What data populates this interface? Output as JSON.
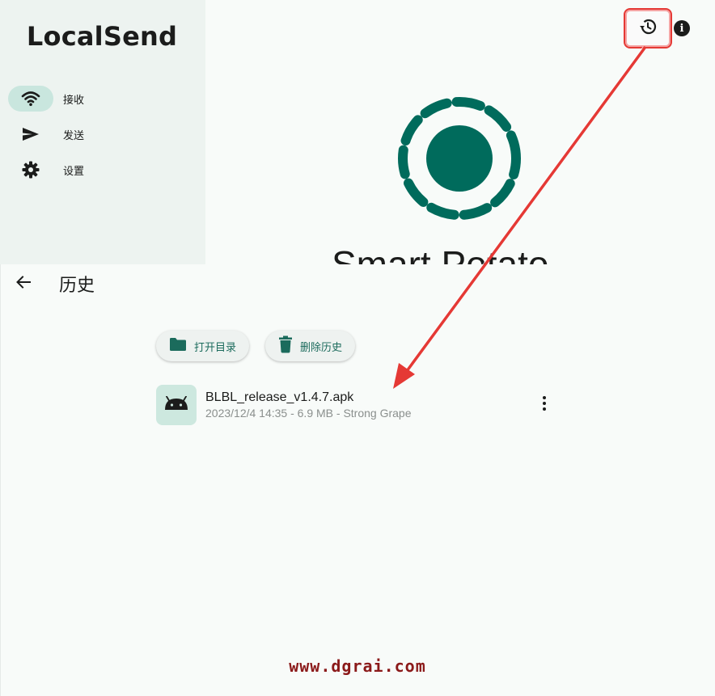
{
  "app": {
    "title": "LocalSend"
  },
  "sidebar": {
    "items": [
      {
        "label": "接收",
        "icon": "wifi-icon",
        "active": true
      },
      {
        "label": "发送",
        "icon": "send-icon",
        "active": false
      },
      {
        "label": "设置",
        "icon": "gear-icon",
        "active": false
      }
    ]
  },
  "top_actions": {
    "history_icon": "history-icon",
    "info_icon": "info-icon",
    "info_glyph": "i"
  },
  "device": {
    "name": "Smart Potato"
  },
  "history": {
    "title": "历史",
    "open_folder_label": "打开目录",
    "delete_history_label": "删除历史",
    "files": [
      {
        "name": "BLBL_release_v1.4.7.apk",
        "meta": "2023/12/4 14:35 - 6.9 MB - Strong Grape",
        "icon": "android-icon"
      }
    ]
  },
  "watermark": "www.dgrai.com",
  "colors": {
    "accent": "#1b6b5c",
    "logo": "#006b5c",
    "active_pill": "#c9e6de",
    "annotation_red": "#e53935",
    "watermark": "#8b1a1a"
  }
}
